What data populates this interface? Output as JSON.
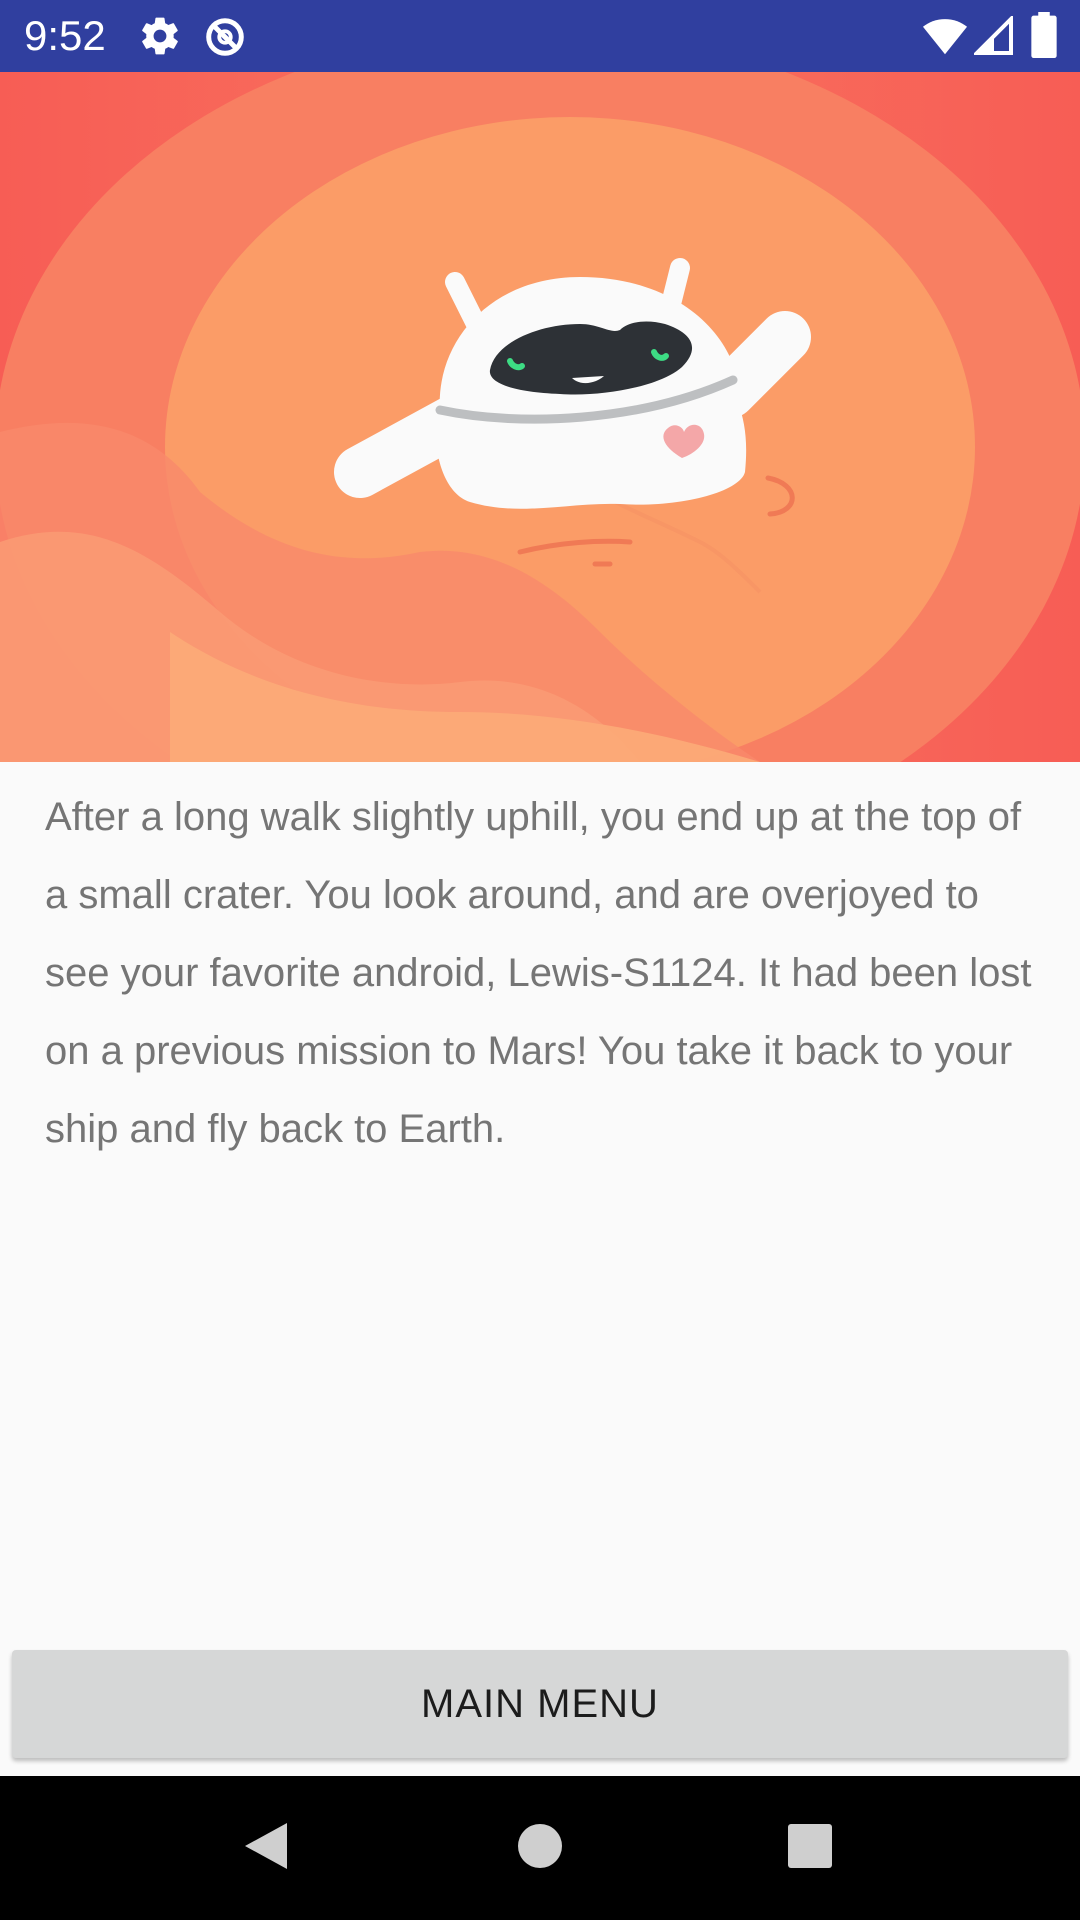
{
  "status_bar": {
    "time": "9:52",
    "icons": [
      "gear-icon",
      "data-saver-icon",
      "wifi-icon",
      "signal-icon",
      "battery-icon"
    ]
  },
  "hero": {
    "illustration": "waving-android-robot-mars",
    "colors": {
      "outer": "#f7655a",
      "ring": "#f98a68",
      "inner": "#fb9d68",
      "robot": "#fafafa",
      "visor": "#2d3136",
      "eyes": "#3ddc84",
      "heart": "#f4a7a8"
    }
  },
  "story": {
    "text": "After a long walk slightly uphill, you end up at the top of a small crater. You look around, and are overjoyed to see your favorite android, Lewis-S1124. It had been lost on a previous mission to Mars! You take it back to your ship and fly back to Earth."
  },
  "main_menu": {
    "label": "MAIN MENU"
  },
  "nav_bar": {
    "buttons": [
      "back-icon",
      "home-icon",
      "recents-icon"
    ]
  },
  "colors": {
    "status_bar": "#303f9f",
    "button_bg": "#d6d7d7",
    "story_text": "#757575"
  }
}
